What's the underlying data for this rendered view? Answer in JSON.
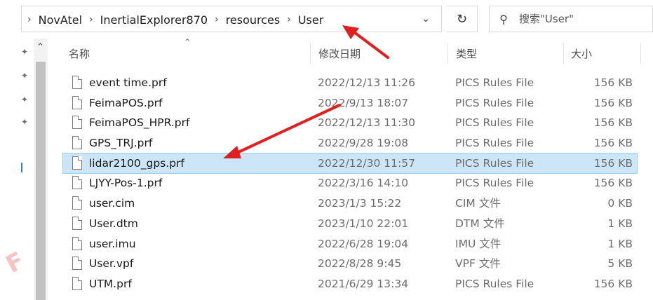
{
  "breadcrumb": [
    "NovAtel",
    "InertialExplorer870",
    "resources",
    "User"
  ],
  "search": {
    "placeholder": "搜索\"User\""
  },
  "columns": {
    "name": "名称",
    "date": "修改日期",
    "type": "类型",
    "size": "大小"
  },
  "files": [
    {
      "name": "event time.prf",
      "date": "2022/12/13 11:26",
      "type": "PICS Rules File",
      "size": "156 KB",
      "selected": false
    },
    {
      "name": "FeimaPOS.prf",
      "date": "2022/9/13 18:07",
      "type": "PICS Rules File",
      "size": "156 KB",
      "selected": false
    },
    {
      "name": "FeimaPOS_HPR.prf",
      "date": "2022/12/13 11:30",
      "type": "PICS Rules File",
      "size": "156 KB",
      "selected": false
    },
    {
      "name": "GPS_TRJ.prf",
      "date": "2022/9/28 19:08",
      "type": "PICS Rules File",
      "size": "156 KB",
      "selected": false
    },
    {
      "name": "lidar2100_gps.prf",
      "date": "2022/12/30 11:57",
      "type": "PICS Rules File",
      "size": "156 KB",
      "selected": true
    },
    {
      "name": "LJYY-Pos-1.prf",
      "date": "2022/3/16 14:10",
      "type": "PICS Rules File",
      "size": "156 KB",
      "selected": false
    },
    {
      "name": "user.cim",
      "date": "2023/1/3 15:22",
      "type": "CIM 文件",
      "size": "0 KB",
      "selected": false
    },
    {
      "name": "User.dtm",
      "date": "2023/1/10 22:01",
      "type": "DTM 文件",
      "size": "1 KB",
      "selected": false
    },
    {
      "name": "user.imu",
      "date": "2022/6/28 19:04",
      "type": "IMU 文件",
      "size": "1 KB",
      "selected": false
    },
    {
      "name": "User.vpf",
      "date": "2022/8/28 9:45",
      "type": "VPF 文件",
      "size": "5 KB",
      "selected": false
    },
    {
      "name": "UTM.prf",
      "date": "2021/6/29 13:34",
      "type": "PICS Rules File",
      "size": "156 KB",
      "selected": false
    }
  ],
  "icons": {
    "breadcrumb_separator": "chevron-right-icon",
    "address_dropdown": "chevron-down-icon",
    "refresh": "refresh-icon",
    "search": "search-icon",
    "file": "file-icon",
    "pin": "pin-icon",
    "sort": "sort-up-icon",
    "annotation": "red-arrow-icon"
  },
  "colors": {
    "selection": "#cde6f7",
    "selection_border": "#99d1ff",
    "annotation": "#e02020"
  }
}
